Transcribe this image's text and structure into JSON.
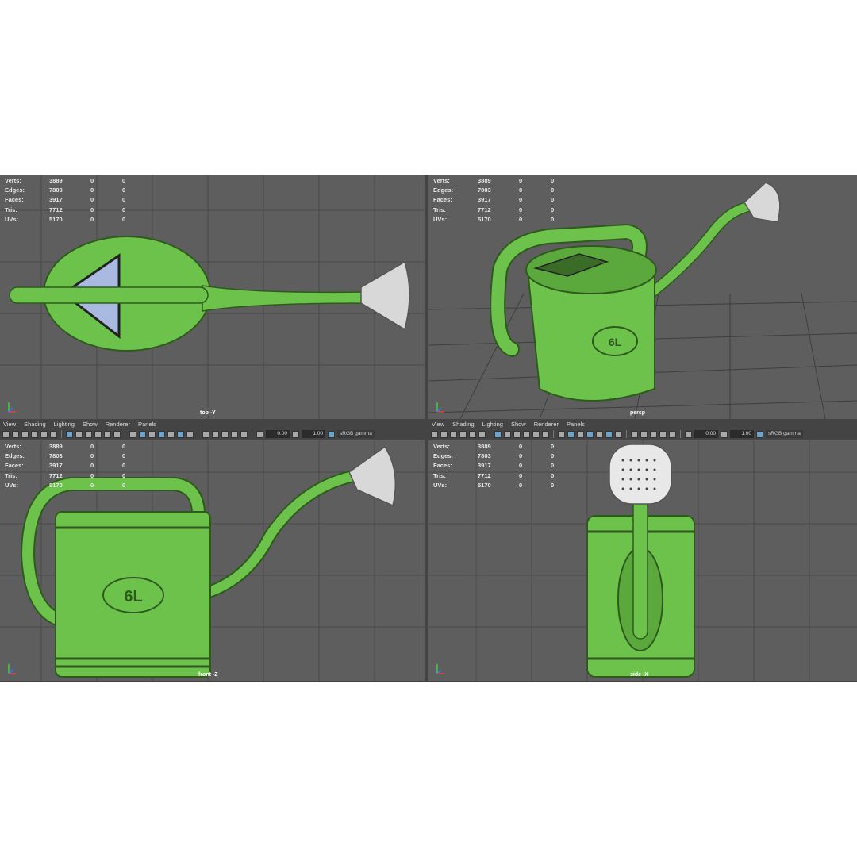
{
  "stats": {
    "rows": [
      {
        "label": "Verts:",
        "v1": "3889",
        "v2": "0",
        "v3": "0"
      },
      {
        "label": "Edges:",
        "v1": "7803",
        "v2": "0",
        "v3": "0"
      },
      {
        "label": "Faces:",
        "v1": "3917",
        "v2": "0",
        "v3": "0"
      },
      {
        "label": "Tris:",
        "v1": "7712",
        "v2": "0",
        "v3": "0"
      },
      {
        "label": "UVs:",
        "v1": "5170",
        "v2": "0",
        "v3": "0"
      }
    ]
  },
  "viewports": {
    "top": {
      "camera": "top -Y"
    },
    "persp": {
      "camera": "persp"
    },
    "front": {
      "camera": "front -Z"
    },
    "side": {
      "camera": "side -X"
    }
  },
  "panel_menu": {
    "view": "View",
    "shading": "Shading",
    "lighting": "Lighting",
    "show": "Show",
    "renderer": "Renderer",
    "panels": "Panels"
  },
  "panel_toolbar": {
    "exposure": "0.00",
    "gamma": "1.00",
    "color_space": "sRGB gamma"
  },
  "model": {
    "label": "6L",
    "body_color": "#6cc24a",
    "spout_color": "#cfcfcf"
  },
  "colors": {
    "viewport_bg": "#5e5e5e",
    "grid": "#4a4a4a",
    "panel_bg": "#444444"
  }
}
